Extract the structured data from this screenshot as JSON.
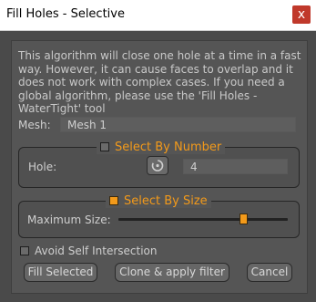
{
  "window": {
    "title": "Fill Holes - Selective",
    "close_glyph": "x"
  },
  "description": "This algorithm will close one hole at a time in a fast way. However, it can cause faces to overlap and it does not work with complex cases. If you need a global algorithm, please use the 'Fill Holes - WaterTight' tool",
  "mesh": {
    "label": "Mesh:",
    "value": "Mesh 1"
  },
  "select_by_number": {
    "title": "Select By Number",
    "checked": false,
    "hole_label": "Hole:",
    "hole_value": "4",
    "pick_icon": "target-cycle-icon"
  },
  "select_by_size": {
    "title": "Select By Size",
    "checked": true,
    "max_size_label": "Maximum Size:",
    "slider_fraction": 0.74
  },
  "avoid_self_intersection": {
    "label": "Avoid Self Intersection",
    "checked": false
  },
  "buttons": {
    "fill_selected": "Fill Selected",
    "clone_apply": "Clone & apply filter",
    "cancel": "Cancel"
  },
  "colors": {
    "accent": "#f39a1a",
    "close": "#c0392b"
  }
}
